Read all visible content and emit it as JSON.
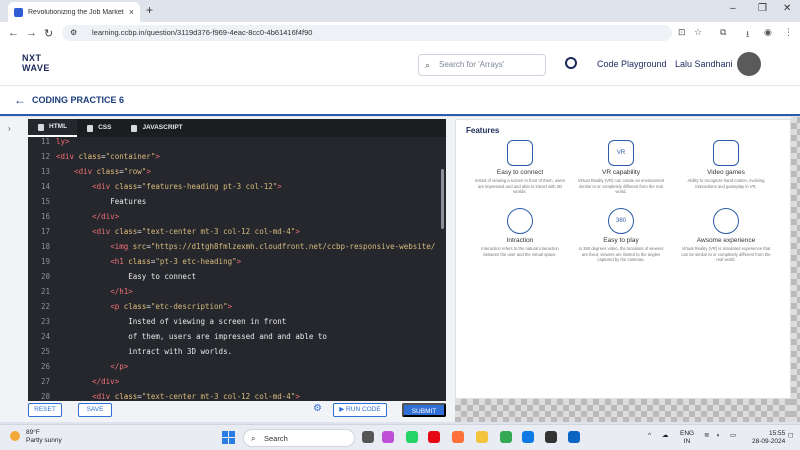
{
  "browser": {
    "tab_title": "Revolutionizing the Job Market",
    "tab_close": "×",
    "new_tab": "+",
    "url": "learning.ccbp.in/question/3119d376-f969-4eac-8cc0-4b61416f4f90",
    "win_min": "–",
    "win_max": "❐",
    "win_close": "✕"
  },
  "header": {
    "logo_line1": "NXT",
    "logo_line2": "WAVE",
    "search_placeholder": "Search for 'Arrays'",
    "code_playground": "Code Playground",
    "username": "Lalu Sandhani"
  },
  "practice": {
    "title": "CODING PRACTICE 6"
  },
  "editor": {
    "tabs": [
      "HTML",
      "CSS",
      "JAVASCRIPT"
    ],
    "lines": [
      {
        "n": "11",
        "html": "<span class='tag'>ly&gt;</span>"
      },
      {
        "n": "12",
        "html": "<span class='tag'>&lt;div</span> <span class='attr'>class</span>=<span class='str'>\"container\"</span><span class='tag'>&gt;</span>"
      },
      {
        "n": "13",
        "html": "    <span class='tag'>&lt;div</span> <span class='attr'>class</span>=<span class='str'>\"row\"</span><span class='tag'>&gt;</span>"
      },
      {
        "n": "14",
        "html": "        <span class='tag'>&lt;div</span> <span class='attr'>class</span>=<span class='str'>\"features-heading pt-3 col-12\"</span><span class='tag'>&gt;</span>"
      },
      {
        "n": "15",
        "html": "            <span class='txt'>Features</span>"
      },
      {
        "n": "16",
        "html": "        <span class='tag'>&lt;/div&gt;</span>"
      },
      {
        "n": "17",
        "html": "        <span class='tag'>&lt;div</span> <span class='attr'>class</span>=<span class='str'>\"text-center mt-3 col-12 col-md-4\"</span><span class='tag'>&gt;</span>"
      },
      {
        "n": "18",
        "html": "            <span class='tag'>&lt;img</span> <span class='attr'>src</span>=<span class='str'>\"https://d1tgh8fmlzexmh.cloudfront.net/ccbp-responsive-website/</span>"
      },
      {
        "n": "19",
        "html": "            <span class='tag'>&lt;h1</span> <span class='attr'>class</span>=<span class='str'>\"pt-3 etc-heading\"</span><span class='tag'>&gt;</span>"
      },
      {
        "n": "20",
        "html": "                <span class='txt'>Easy to connect</span>"
      },
      {
        "n": "21",
        "html": "            <span class='tag'>&lt;/h1&gt;</span>"
      },
      {
        "n": "22",
        "html": "            <span class='tag'>&lt;p</span> <span class='attr'>class</span>=<span class='str'>\"etc-description\"</span><span class='tag'>&gt;</span>"
      },
      {
        "n": "23",
        "html": "                <span class='txt'>Insted of viewing a screen in front</span>"
      },
      {
        "n": "24",
        "html": "                <span class='txt'>of them, users are impressed and and able to</span>"
      },
      {
        "n": "25",
        "html": "                <span class='txt'>intract with 3D worlds.</span>"
      },
      {
        "n": "26",
        "html": "            <span class='tag'>&lt;/p&gt;</span>"
      },
      {
        "n": "27",
        "html": "        <span class='tag'>&lt;/div&gt;</span>"
      },
      {
        "n": "28",
        "html": "        <span class='tag'>&lt;div</span> <span class='attr'>class</span>=<span class='str'>\"text-center mt-3 col-12 col-md-4\"</span><span class='tag'>&gt;</span>"
      }
    ]
  },
  "actions": {
    "reset": "RESET",
    "save": "SAVE",
    "run": "▶ RUN CODE",
    "submit": "SUBMIT"
  },
  "preview": {
    "heading": "Features",
    "features": [
      {
        "name": "Easy to connect",
        "desc": "Insted of viewing a screen in front of them, users are impressed and and able to intract with 3D worlds."
      },
      {
        "name": "VR capability",
        "desc": "Virtual Reality (VR) can create an environment similar to or completely different from the real world."
      },
      {
        "name": "Video games",
        "desc": "Ability to recognize hand motion, evolving interactions and gameplay in VR."
      },
      {
        "name": "Intraction",
        "desc": "Interaction refers to the natural interaction between the user and the virtual space."
      },
      {
        "name": "Easy to play",
        "desc": "In 360 degrees video, the locations of viewers are fixed, viewers are limited to the angles captured by the cameras."
      },
      {
        "name": "Awsome experience",
        "desc": "Virtual Reality (VR) is simulated experience that can be similar to or completely different from the real world."
      }
    ],
    "icon_text_vr": "VR",
    "icon_text_360": "360"
  },
  "taskbar": {
    "temp": "89°F",
    "weather": "Partly sunny",
    "search": "Search",
    "lang1": "ENG",
    "lang2": "IN",
    "time": "15:55",
    "date": "28-09-2024"
  }
}
